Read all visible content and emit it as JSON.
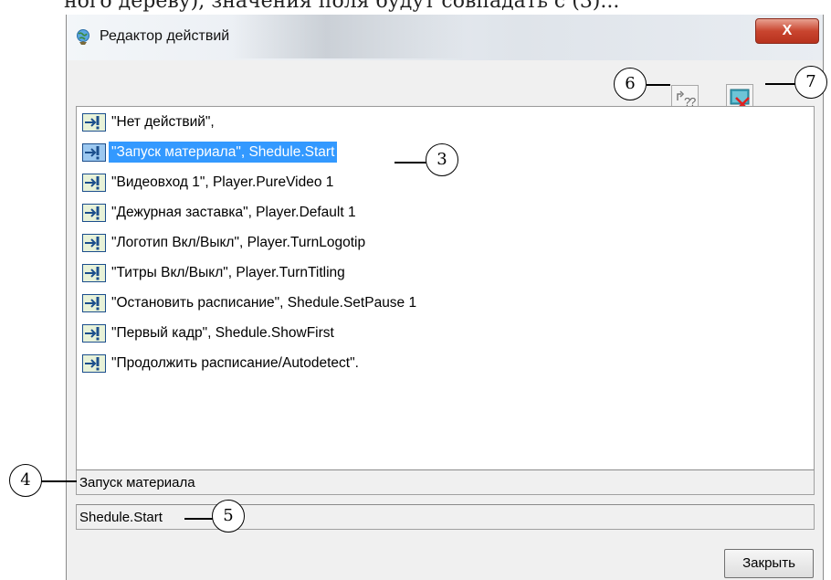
{
  "top_caption": "ного дереву), значения поля будут совпадать с (3)...",
  "window": {
    "title": "Редактор действий",
    "close_glyph": "X",
    "title_icon": "globe-icon"
  },
  "toolbar": {
    "help_icon": "help-arrow-icon",
    "delete_icon": "delete-icon"
  },
  "actions_list": {
    "items": [
      {
        "text": "\"Нет действий\","
      },
      {
        "text": "\"Запуск материала\",    Shedule.Start",
        "selected": true
      },
      {
        "text": "\"Видеовход 1\",    Player.PureVideo 1"
      },
      {
        "text": "\"Дежурная заставка\",    Player.Default 1"
      },
      {
        "text": "\"Логотип Вкл/Выкл\",    Player.TurnLogotip"
      },
      {
        "text": "\"Титры Вкл/Выкл\",    Player.TurnTitling"
      },
      {
        "text": "\"Остановить расписание\",    Shedule.SetPause 1"
      },
      {
        "text": "\"Первый кадр\",    Shedule.ShowFirst"
      },
      {
        "text": "\"Продолжить расписание/Autodetect\"."
      }
    ]
  },
  "fields": {
    "name_value": "Запуск материала",
    "id_value": "Shedule.Start"
  },
  "buttons": {
    "close_label": "Закрыть"
  },
  "callouts": {
    "c3": "3",
    "c4": "4",
    "c5": "5",
    "c6": "6",
    "c7": "7"
  },
  "colors": {
    "selection": "#3399ff",
    "close_button_red": "#c9452f"
  }
}
